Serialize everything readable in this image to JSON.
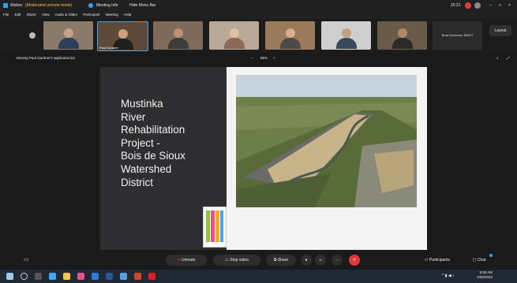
{
  "window": {
    "app_name": "Webex",
    "meeting_type": "(Moderated unmute mode)",
    "meeting_info": "Meeting Info",
    "hide_menu_bar": "Hide Menu Bar",
    "clock": "25:21"
  },
  "menu": [
    "File",
    "Edit",
    "Share",
    "View",
    "Audio & Video",
    "Participant",
    "Meeting",
    "Help"
  ],
  "participants": [
    {
      "name": ""
    },
    {
      "name": "Paul Gardner"
    },
    {
      "name": ""
    },
    {
      "name": ""
    },
    {
      "name": ""
    },
    {
      "name": ""
    },
    {
      "name": ""
    }
  ],
  "brad_tile": "Brad Gausman MNDT",
  "layout_button": "Layout",
  "viewing_text": "Viewing Paul Gardner's application(s)",
  "zoom_level": "85%",
  "slide": {
    "title_lines": [
      "Mustinka",
      "River",
      "Rehabilitation",
      "Project -",
      "Bois de Sioux",
      "Watershed",
      "District"
    ]
  },
  "controls": {
    "unmute": "Unmute",
    "stop_video": "Stop video",
    "share": "Share",
    "participants": "Participants",
    "chat": "Chat"
  },
  "taskbar": {
    "time": "9:55 AM",
    "date": "10/6/2023"
  },
  "colors": {
    "end_button": "#e5383b",
    "unmute_icon": "#e5383b",
    "accent": "#2ea3f2"
  }
}
